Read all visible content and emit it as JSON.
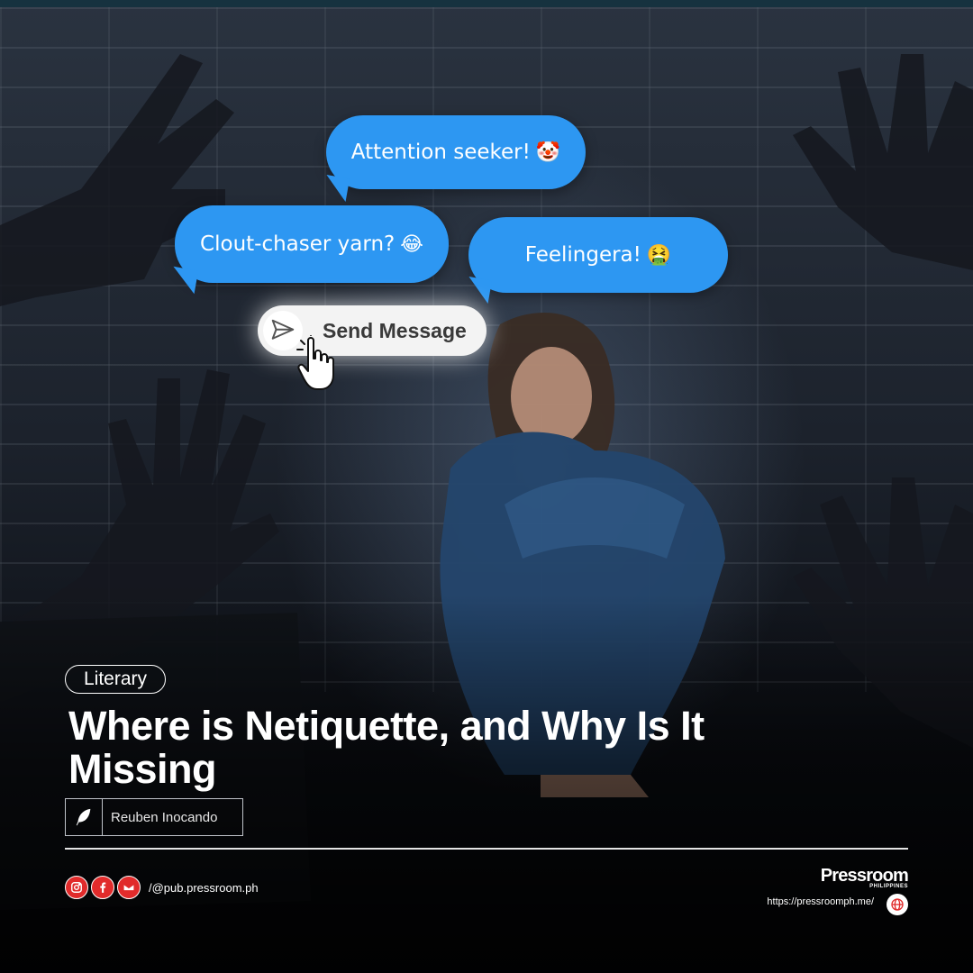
{
  "bubbles": {
    "first": {
      "text": "Attention seeker!",
      "emoji": "🤡"
    },
    "second": {
      "text": "Clout-chaser yarn?",
      "emoji": "😂"
    },
    "third": {
      "text": "Feelingera!",
      "emoji": "🤮"
    }
  },
  "send_button": {
    "label": "Send Message"
  },
  "article": {
    "category": "Literary",
    "title": "Where is Netiquette, and Why Is It Missing",
    "author": "Reuben Inocando"
  },
  "footer": {
    "social_handle": "/@pub.pressroom.ph",
    "brand_name": "Pressroom",
    "brand_sub": "PHILIPPINES",
    "website": "https://pressroomph.me/"
  },
  "colors": {
    "bubble": "#2d97f2",
    "social_icon": "#e12b2b",
    "text": "#ffffff"
  },
  "icons": [
    "send-icon",
    "pointer-cursor-icon",
    "quill-icon",
    "instagram-icon",
    "facebook-icon",
    "email-icon",
    "globe-icon"
  ]
}
